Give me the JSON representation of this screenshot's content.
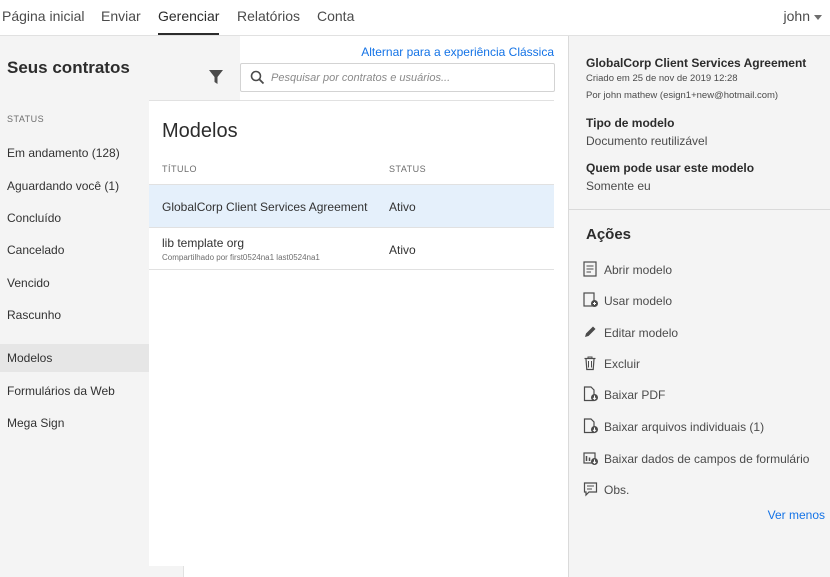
{
  "nav": {
    "tabs": [
      "Página inicial",
      "Enviar",
      "Gerenciar",
      "Relatórios",
      "Conta"
    ],
    "active": "Gerenciar",
    "user": "john"
  },
  "sidebar": {
    "title": "Seus contratos",
    "status_label": "STATUS",
    "items": [
      {
        "label": "Em andamento (128)"
      },
      {
        "label": "Aguardando você (1)"
      },
      {
        "label": "Concluído"
      },
      {
        "label": "Cancelado"
      },
      {
        "label": "Vencido"
      },
      {
        "label": "Rascunho"
      },
      {
        "label": "Modelos"
      },
      {
        "label": "Formulários da Web"
      },
      {
        "label": "Mega Sign"
      }
    ],
    "active": "Modelos"
  },
  "header": {
    "switch_link": "Alternar para a experiência Clássica",
    "search_placeholder": "Pesquisar por contratos e usuários..."
  },
  "main": {
    "title": "Modelos",
    "columns": {
      "title": "TÍTULO",
      "status": "STATUS"
    },
    "rows": [
      {
        "title": "GlobalCorp Client Services Agreement",
        "sub": "",
        "status": "Ativo"
      },
      {
        "title": "lib template org",
        "sub": "Compartilhado por first0524na1 last0524na1",
        "status": "Ativo"
      }
    ]
  },
  "detail": {
    "agreement_name": "GlobalCorp Client Services Agreement",
    "created": "Criado em 25 de nov de 2019 12:28",
    "by": "Por john mathew (esign1+new@hotmail.com)",
    "type_label": "Tipo de modelo",
    "type_value": "Documento reutilizável",
    "who_label": "Quem pode usar este modelo",
    "who_value": "Somente eu",
    "actions_title": "Ações",
    "actions": [
      {
        "label": "Abrir modelo",
        "icon": "open-template-icon"
      },
      {
        "label": "Usar modelo",
        "icon": "use-template-icon"
      },
      {
        "label": "Editar modelo",
        "icon": "pencil-icon"
      },
      {
        "label": "Excluir",
        "icon": "trash-icon"
      },
      {
        "label": "Baixar PDF",
        "icon": "download-pdf-icon"
      },
      {
        "label": "Baixar arquivos individuais (1)",
        "icon": "download-files-icon"
      },
      {
        "label": "Baixar dados de campos de formulário",
        "icon": "download-form-data-icon"
      },
      {
        "label": "Obs.",
        "icon": "notes-icon"
      }
    ],
    "see_less": "Ver menos"
  },
  "colors": {
    "link": "#1473e6",
    "selected_row": "#e5f0fb",
    "sidebar_bg": "#f4f4f4"
  }
}
